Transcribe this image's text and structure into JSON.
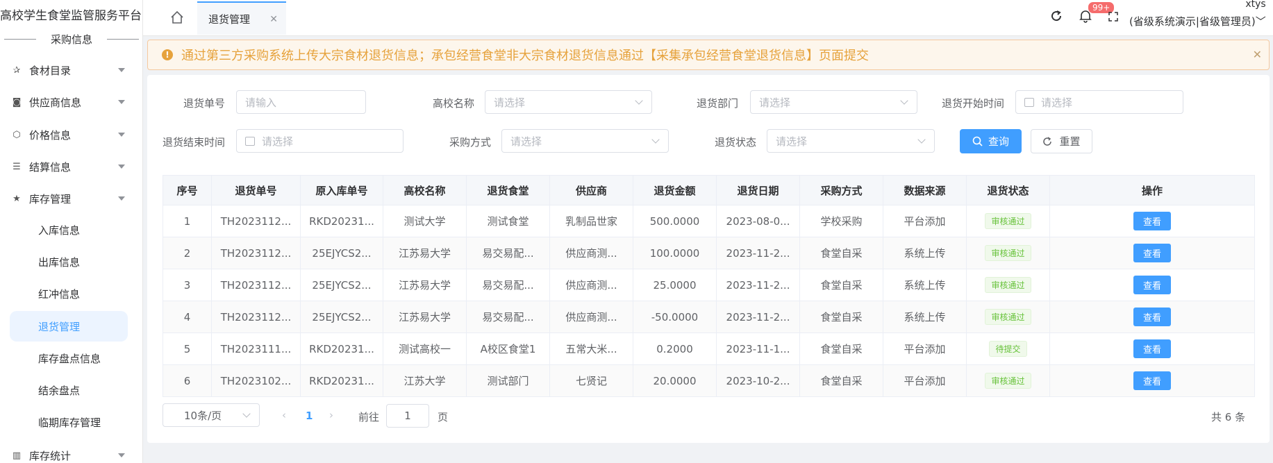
{
  "sidebar": {
    "brand": "高校学生食堂监管服务平台",
    "section": "采购信息",
    "menu": [
      {
        "label": "食材目录",
        "icon": "star-pin-icon"
      },
      {
        "label": "供应商信息",
        "icon": "camera-icon"
      },
      {
        "label": "价格信息",
        "icon": "cube-icon"
      },
      {
        "label": "结算信息",
        "icon": "list-icon"
      },
      {
        "label": "库存管理",
        "icon": "star-icon"
      }
    ],
    "sub_items": [
      "入库信息",
      "出库信息",
      "红冲信息",
      "退货管理",
      "库存盘点信息",
      "结余盘点",
      "临期库存管理"
    ],
    "bottom_item": {
      "label": "库存统计",
      "icon": "chart-icon"
    }
  },
  "header": {
    "active_tab": "退货管理",
    "notification_count": "99+",
    "user_name": "xtys",
    "user_role": "(省级系统演示|省级管理员)"
  },
  "alert": {
    "text": "通过第三方采购系统上传大宗食材退货信息；承包经营食堂非大宗食材退货信息通过【采集承包经营食堂退货信息】页面提交"
  },
  "filters": {
    "return_no_label": "退货单号",
    "return_no_placeholder": "请输入",
    "school_label": "高校名称",
    "school_placeholder": "请选择",
    "dept_label": "退货部门",
    "dept_placeholder": "请选择",
    "start_label": "退货开始时间",
    "start_placeholder": "请选择",
    "end_label": "退货结束时间",
    "end_placeholder": "请选择",
    "method_label": "采购方式",
    "method_placeholder": "请选择",
    "status_label": "退货状态",
    "status_placeholder": "请选择",
    "query_label": "查询",
    "reset_label": "重置"
  },
  "table": {
    "headers": [
      "序号",
      "退货单号",
      "原入库单号",
      "高校名称",
      "退货食堂",
      "供应商",
      "退货金额",
      "退货日期",
      "采购方式",
      "数据来源",
      "退货状态",
      "操作"
    ],
    "action_label": "查看",
    "rows": [
      [
        "1",
        "TH2023112...",
        "RKD20231...",
        "测试大学",
        "测试食堂",
        "乳制品世家",
        "500.0000",
        "2023-08-0...",
        "学校采购",
        "平台添加",
        "审核通过"
      ],
      [
        "2",
        "TH2023112...",
        "25EJYCS2...",
        "江苏易大学",
        "易交易配...",
        "供应商测...",
        "100.0000",
        "2023-11-2...",
        "食堂自采",
        "系统上传",
        "审核通过"
      ],
      [
        "3",
        "TH2023112...",
        "25EJYCS2...",
        "江苏易大学",
        "易交易配...",
        "供应商测...",
        "25.0000",
        "2023-11-2...",
        "食堂自采",
        "系统上传",
        "审核通过"
      ],
      [
        "4",
        "TH2023112...",
        "25EJYCS2...",
        "江苏易大学",
        "易交易配...",
        "供应商测...",
        "-50.0000",
        "2023-11-2...",
        "食堂自采",
        "系统上传",
        "审核通过"
      ],
      [
        "5",
        "TH2023111...",
        "RKD20231...",
        "测试高校一",
        "A校区食堂1",
        "五常大米...",
        "0.2000",
        "2023-11-1...",
        "食堂自采",
        "平台添加",
        "待提交"
      ],
      [
        "6",
        "TH2023102...",
        "RKD20231...",
        "江苏大学",
        "测试部门",
        "七贤记",
        "20.0000",
        "2023-10-2...",
        "食堂自采",
        "平台添加",
        "审核通过"
      ]
    ]
  },
  "pagination": {
    "page_size": "10条/页",
    "current_page": "1",
    "goto_label": "前往",
    "goto_value": "1",
    "page_unit": "页",
    "total": "共 6 条"
  },
  "colors": {
    "primary": "#409eff",
    "warning": "#e6a23c",
    "success": "#67c23a"
  }
}
